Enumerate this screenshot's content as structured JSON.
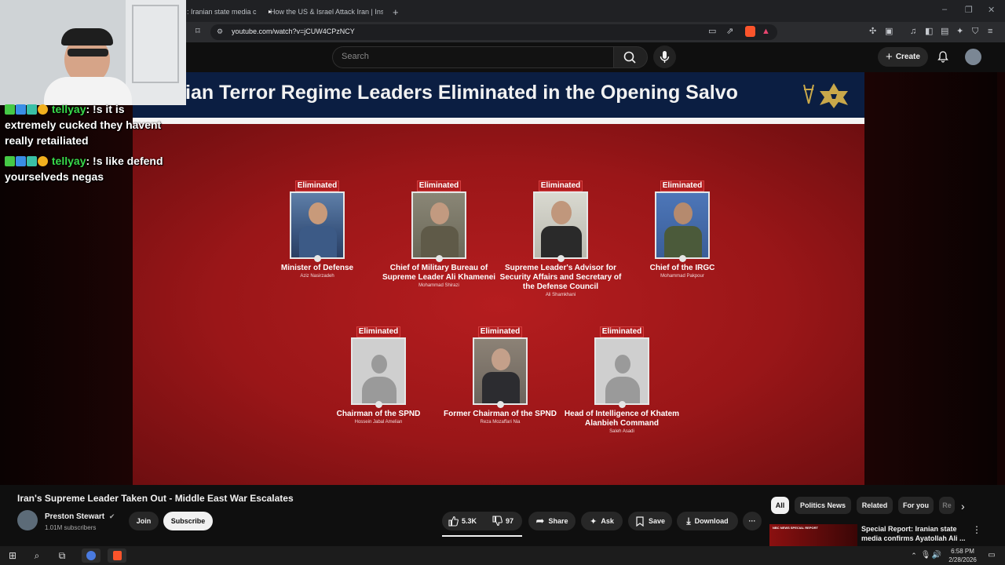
{
  "browser": {
    "tabs": [
      {
        "label": ": Iranian state media c"
      },
      {
        "label": "How the US & Israel Attack Iran | Insi"
      }
    ],
    "new_tab_label": "+",
    "url": "youtube.com/watch?v=jCUW4CPzNCY"
  },
  "youtube": {
    "search_placeholder": "Search",
    "create_label": "Create"
  },
  "video_frame": {
    "banner_title": "ian Terror Regime Leaders Eliminated in the Opening Salvo",
    "cards": [
      {
        "badge": "Eliminated",
        "role": "Minister of Defense",
        "name": "Aziz Nasirzadeh"
      },
      {
        "badge": "Eliminated",
        "role": "Chief of Military Bureau of Supreme Leader Ali Khamenei",
        "name": "Mohammad Shirazi"
      },
      {
        "badge": "Eliminated",
        "role": "Supreme Leader's Advisor for Security Affairs and Secretary of the Defense Council",
        "name": "Ali Shamkhani"
      },
      {
        "badge": "Eliminated",
        "role": "Chief of the IRGC",
        "name": "Mohammad Pakpour"
      },
      {
        "badge": "Eliminated",
        "role": "Chairman of the SPND",
        "name": "Hossein Jabal Amelian"
      },
      {
        "badge": "Eliminated",
        "role": "Former Chairman of the SPND",
        "name": "Reza Mozaffari Nia"
      },
      {
        "badge": "Eliminated",
        "role": "Head of Intelligence of Khatem Alanbieh Command",
        "name": "Saleh Asadi"
      }
    ]
  },
  "chat": [
    {
      "user": "tellyay",
      "message": "!s it is extremely cucked they havent really retailiated"
    },
    {
      "user": "tellyay",
      "message": "!s like defend yourselveds negas"
    }
  ],
  "video_info": {
    "title": "Iran's Supreme Leader Taken Out - Middle East War Escalates",
    "channel": "Preston Stewart",
    "subscribers": "1.01M subscribers",
    "join_label": "Join",
    "subscribe_label": "Subscribe",
    "likes": "5.3K",
    "dislikes": "97",
    "share_label": "Share",
    "ask_label": "Ask",
    "save_label": "Save",
    "download_label": "Download",
    "more_label": "···"
  },
  "chips": [
    "All",
    "Politics News",
    "Related",
    "For you",
    "Re"
  ],
  "recommendation": {
    "title": "Special Report: Iranian state media confirms Ayatollah Ali ...",
    "thumb_text": "NBC NEWS SPECIAL REPORT"
  },
  "taskbar": {
    "time": "6:58 PM",
    "date": "2/28/2026"
  },
  "colors": {
    "video_red": "#b51d1f",
    "banner_navy": "#0b1e42",
    "chat_user": "#39d94a",
    "eliminated_badge": "#b01c1e"
  }
}
